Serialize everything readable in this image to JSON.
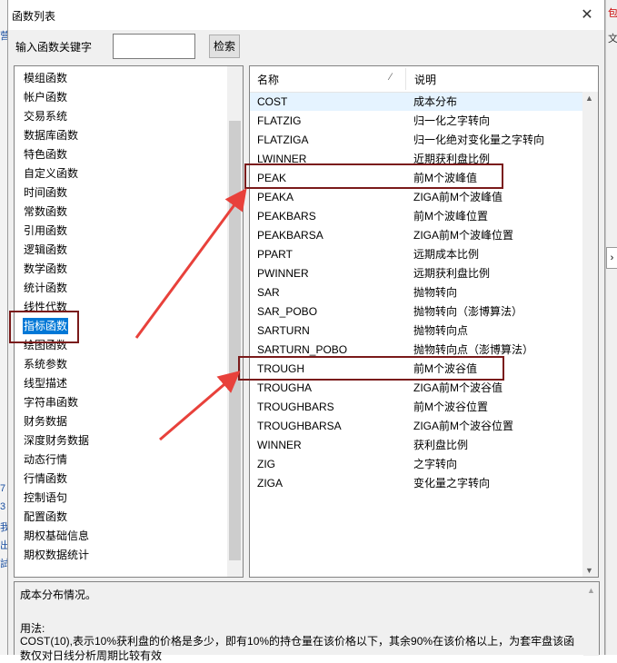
{
  "window": {
    "title": "函数列表",
    "close_glyph": "✕"
  },
  "search": {
    "label": "输入函数关键字",
    "value": "",
    "button_label": "检索"
  },
  "categories": [
    "模组函数",
    "帐户函数",
    "交易系统",
    "数据库函数",
    "特色函数",
    "自定义函数",
    "时间函数",
    "常数函数",
    "引用函数",
    "逻辑函数",
    "数学函数",
    "统计函数",
    "线性代数",
    "指标函数",
    "绘图函数",
    "系统参数",
    "线型描述",
    "字符串函数",
    "财务数据",
    "深度财务数据",
    "动态行情",
    "行情函数",
    "控制语句",
    "配置函数",
    "期权基础信息",
    "期权数据统计"
  ],
  "selected_category": "指标函数",
  "table": {
    "col_name": "名称",
    "col_desc": "说明",
    "sort_glyph": "∕",
    "rows": [
      {
        "name": "COST",
        "desc": "成本分布"
      },
      {
        "name": "FLATZIG",
        "desc": "归一化之字转向"
      },
      {
        "name": "FLATZIGA",
        "desc": "归一化绝对变化量之字转向"
      },
      {
        "name": "LWINNER",
        "desc": "近期获利盘比例"
      },
      {
        "name": "PEAK",
        "desc": "前M个波峰值"
      },
      {
        "name": "PEAKA",
        "desc": "ZIGA前M个波峰值"
      },
      {
        "name": "PEAKBARS",
        "desc": "前M个波峰位置"
      },
      {
        "name": "PEAKBARSA",
        "desc": "ZIGA前M个波峰位置"
      },
      {
        "name": "PPART",
        "desc": "远期成本比例"
      },
      {
        "name": "PWINNER",
        "desc": "远期获利盘比例"
      },
      {
        "name": "SAR",
        "desc": "抛物转向"
      },
      {
        "name": "SAR_POBO",
        "desc": "抛物转向（澎博算法）"
      },
      {
        "name": "SARTURN",
        "desc": "抛物转向点"
      },
      {
        "name": "SARTURN_POBO",
        "desc": "抛物转向点（澎博算法）"
      },
      {
        "name": "TROUGH",
        "desc": "前M个波谷值"
      },
      {
        "name": "TROUGHA",
        "desc": "ZIGA前M个波谷值"
      },
      {
        "name": "TROUGHBARS",
        "desc": "前M个波谷位置"
      },
      {
        "name": "TROUGHBARSA",
        "desc": "ZIGA前M个波谷位置"
      },
      {
        "name": "WINNER",
        "desc": "获利盘比例"
      },
      {
        "name": "ZIG",
        "desc": "之字转向"
      },
      {
        "name": "ZIGA",
        "desc": "变化量之字转向"
      }
    ]
  },
  "description": {
    "summary": "成本分布情况。",
    "usage_label": "用法:",
    "usage_text": "COST(10),表示10%获利盘的价格是多少，即有10%的持仓量在该价格以下，其余90%在该价格以上，为套牢盘该函数仅对日线分析周期比较有效"
  },
  "side_fragments": {
    "left": [
      "营",
      "7",
      "3",
      "我",
      "出",
      "試"
    ],
    "right_top": "包",
    "right_mid": "文",
    "right_arrow": "›"
  },
  "colors": {
    "highlight_box": "#7a1a1a",
    "arrow": "#e8413b",
    "selection": "#0078d7"
  }
}
